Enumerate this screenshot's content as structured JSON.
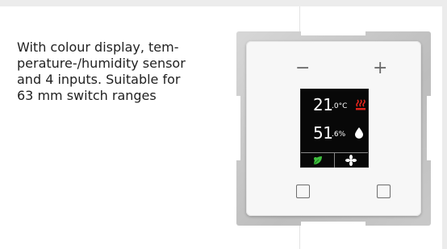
{
  "description": "With colour display, tem-\nperature-/humidity sensor\nand 4 inputs. Suitable for\n63 mm switch ranges",
  "device": {
    "minus_label": "−",
    "plus_label": "+",
    "temperature": {
      "value": "21",
      "unit": ".0°C"
    },
    "humidity": {
      "value": "51",
      "unit": ".6%"
    },
    "icons": {
      "heating": "heating-icon",
      "humidity": "water-drop-icon",
      "eco": "leaf-icon",
      "fan": "fan-icon"
    },
    "colors": {
      "heating": "#e0241b",
      "eco": "#3fbf3f",
      "display": "#080808"
    }
  }
}
